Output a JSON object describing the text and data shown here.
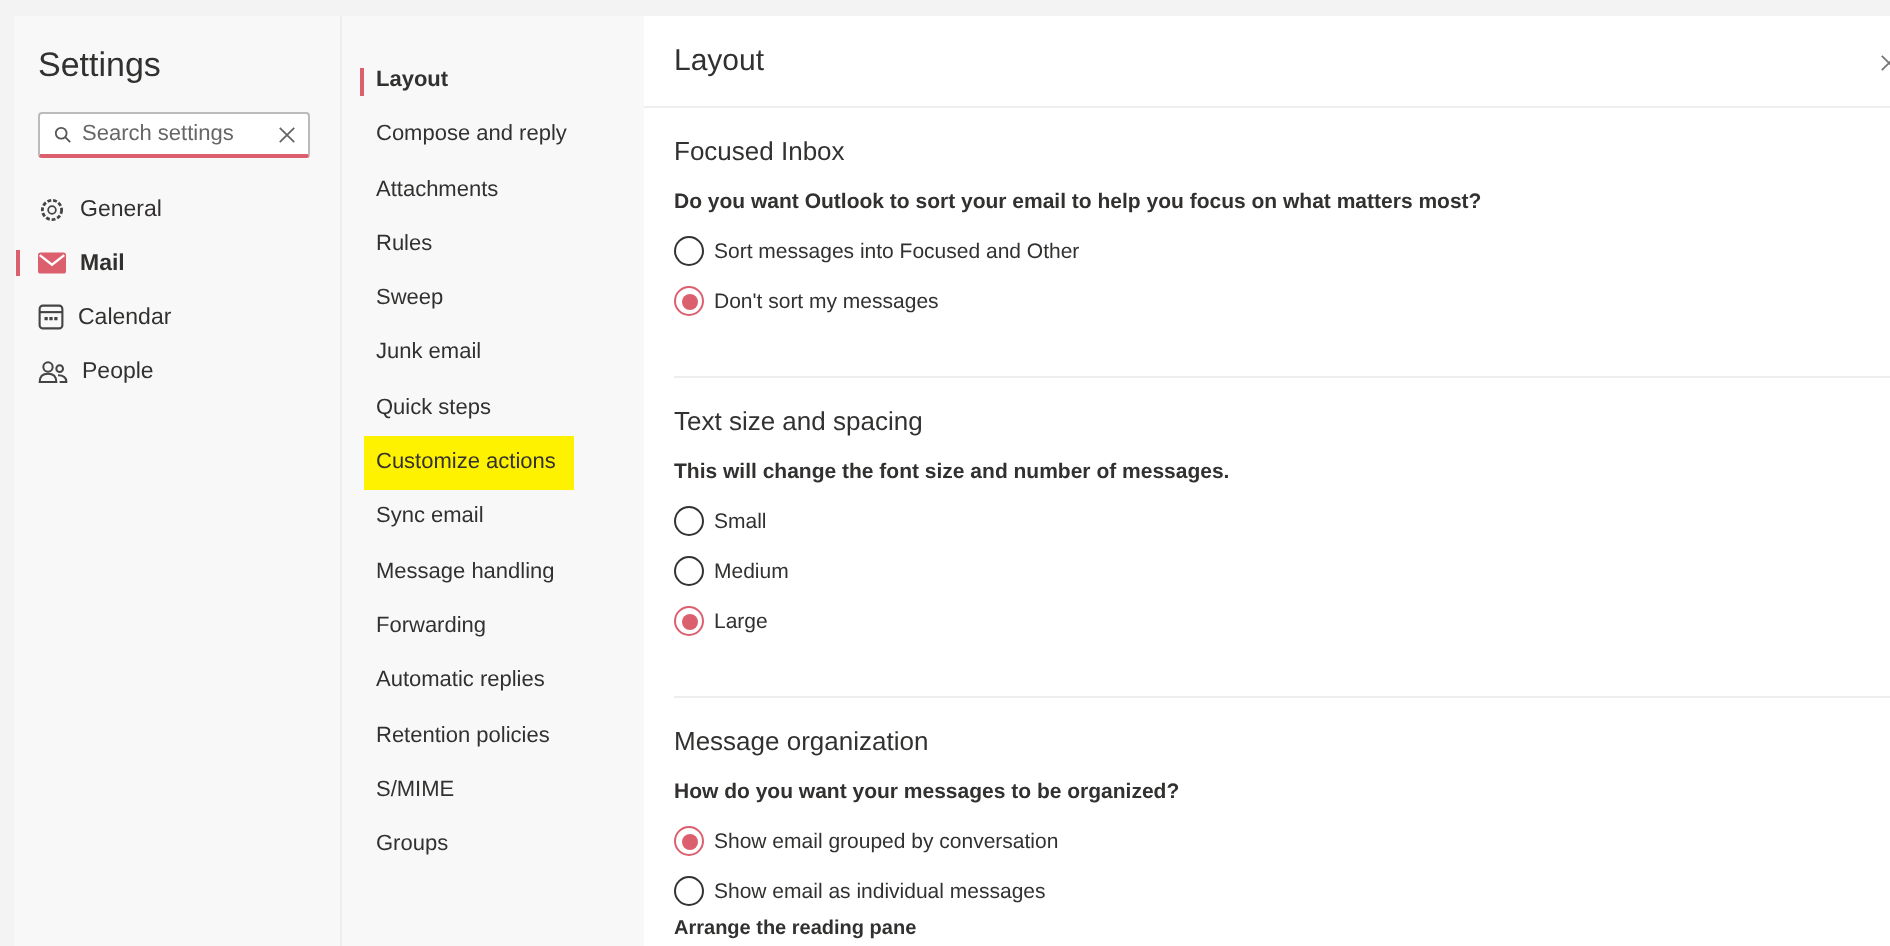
{
  "title": "Settings",
  "search": {
    "placeholder": "Search settings"
  },
  "categories": [
    {
      "label": "General",
      "kind": "gear",
      "selected": false
    },
    {
      "label": "Mail",
      "kind": "mail",
      "selected": true
    },
    {
      "label": "Calendar",
      "kind": "calendar",
      "selected": false
    },
    {
      "label": "People",
      "kind": "people",
      "selected": false
    }
  ],
  "subnav": [
    {
      "label": "Layout",
      "selected": true,
      "highlighted": false
    },
    {
      "label": "Compose and reply",
      "selected": false,
      "highlighted": false
    },
    {
      "label": "Attachments",
      "selected": false,
      "highlighted": false
    },
    {
      "label": "Rules",
      "selected": false,
      "highlighted": false
    },
    {
      "label": "Sweep",
      "selected": false,
      "highlighted": false
    },
    {
      "label": "Junk email",
      "selected": false,
      "highlighted": false
    },
    {
      "label": "Quick steps",
      "selected": false,
      "highlighted": false
    },
    {
      "label": "Customize actions",
      "selected": false,
      "highlighted": true
    },
    {
      "label": "Sync email",
      "selected": false,
      "highlighted": false
    },
    {
      "label": "Message handling",
      "selected": false,
      "highlighted": false
    },
    {
      "label": "Forwarding",
      "selected": false,
      "highlighted": false
    },
    {
      "label": "Automatic replies",
      "selected": false,
      "highlighted": false
    },
    {
      "label": "Retention policies",
      "selected": false,
      "highlighted": false
    },
    {
      "label": "S/MIME",
      "selected": false,
      "highlighted": false
    },
    {
      "label": "Groups",
      "selected": false,
      "highlighted": false
    }
  ],
  "page_title": "Layout",
  "sections": [
    {
      "heading": "Focused Inbox",
      "question": "Do you want Outlook to sort your email to help you focus on what matters most?",
      "options": [
        {
          "label": "Sort messages into Focused and Other",
          "selected": false
        },
        {
          "label": "Don't sort my messages",
          "selected": true
        }
      ]
    },
    {
      "heading": "Text size and spacing",
      "question": "This will change the font size and number of messages.",
      "options": [
        {
          "label": "Small",
          "selected": false
        },
        {
          "label": "Medium",
          "selected": false
        },
        {
          "label": "Large",
          "selected": true
        }
      ]
    },
    {
      "heading": "Message organization",
      "question": "How do you want your messages to be organized?",
      "options": [
        {
          "label": "Show email grouped by conversation",
          "selected": true
        },
        {
          "label": "Show email as individual messages",
          "selected": false
        }
      ]
    }
  ],
  "footer_question": "Arrange the reading pane"
}
